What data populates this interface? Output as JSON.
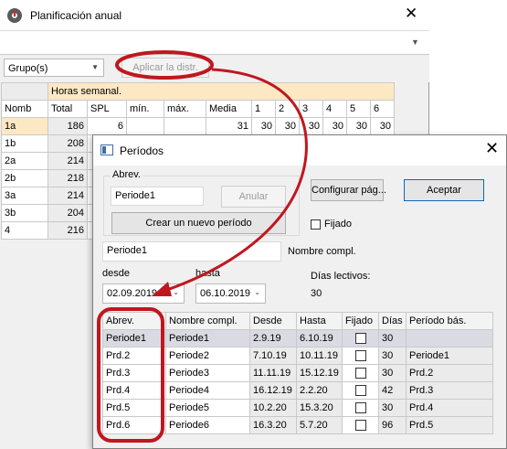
{
  "main_window": {
    "title": "Planificación anual",
    "close_glyph": "✕",
    "group_combo": "Grupo(s)",
    "apply_button": "Aplicar la distr.",
    "table": {
      "header_group": "Horas semanal.",
      "columns": [
        "Nomb",
        "Total",
        "SPL",
        "mín.",
        "máx.",
        "Media",
        "1",
        "2",
        "3",
        "4",
        "5",
        "6"
      ],
      "rows": [
        {
          "name": "1a",
          "total": "186",
          "spl": "6",
          "media": "31",
          "w": [
            "30",
            "30",
            "30",
            "30",
            "30",
            "30"
          ]
        },
        {
          "name": "1b",
          "total": "208"
        },
        {
          "name": "2a",
          "total": "214"
        },
        {
          "name": "2b",
          "total": "218"
        },
        {
          "name": "3a",
          "total": "214"
        },
        {
          "name": "3b",
          "total": "204"
        },
        {
          "name": "4",
          "total": "216"
        }
      ]
    }
  },
  "dialog": {
    "title": "Períodos",
    "close_glyph": "✕",
    "abrev_label": "Abrev.",
    "abrev_value": "Periode1",
    "anular_button": "Anular",
    "new_period_button": "Crear un nuevo período",
    "configure_button": "Configurar pág...",
    "accept_button": "Aceptar",
    "fijado_label": "Fijado",
    "fullname_value": "Periode1",
    "fullname_label": "Nombre compl.",
    "desde_label": "desde",
    "hasta_label": "hasta",
    "desde_value": "02.09.2019",
    "hasta_value": "06.10.2019",
    "dias_label": "Días lectivos:",
    "dias_value": "30",
    "table": {
      "columns": [
        "Abrev.",
        "Nombre compl.",
        "Desde",
        "Hasta",
        "Fijado",
        "Días",
        "Período bás."
      ],
      "rows": [
        {
          "abrev": "Periode1",
          "name": "Periode1",
          "desde": "2.9.19",
          "hasta": "6.10.19",
          "dias": "30",
          "basic": ""
        },
        {
          "abrev": "Prd.2",
          "name": "Periode2",
          "desde": "7.10.19",
          "hasta": "10.11.19",
          "dias": "30",
          "basic": "Periode1"
        },
        {
          "abrev": "Prd.3",
          "name": "Periode3",
          "desde": "11.11.19",
          "hasta": "15.12.19",
          "dias": "30",
          "basic": "Prd.2"
        },
        {
          "abrev": "Prd.4",
          "name": "Periode4",
          "desde": "16.12.19",
          "hasta": "2.2.20",
          "dias": "42",
          "basic": "Prd.3"
        },
        {
          "abrev": "Prd.5",
          "name": "Periode5",
          "desde": "10.2.20",
          "hasta": "15.3.20",
          "dias": "30",
          "basic": "Prd.4"
        },
        {
          "abrev": "Prd.6",
          "name": "Periode6",
          "desde": "16.3.20",
          "hasta": "5.7.20",
          "dias": "96",
          "basic": "Prd.5"
        }
      ]
    }
  },
  "colors": {
    "annotation": "#c0171f",
    "header_peach": "#fde8c4",
    "selected_row": "#dadbe2",
    "accent_border": "#0a66c2"
  }
}
